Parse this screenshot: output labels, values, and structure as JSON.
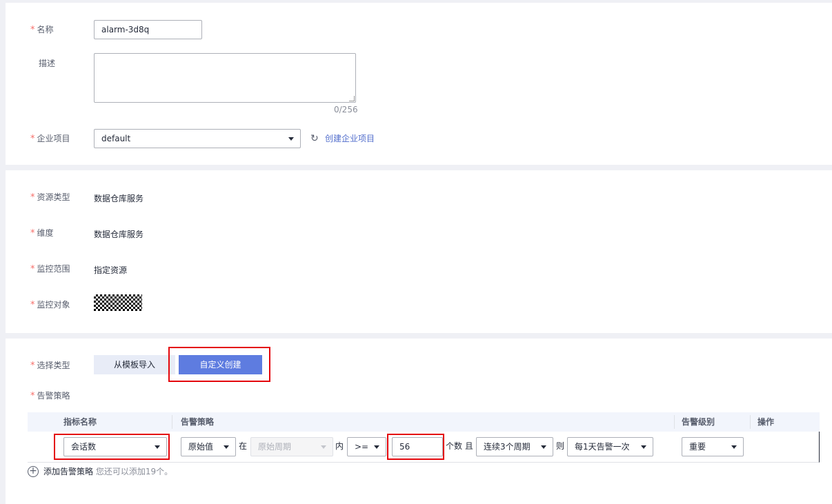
{
  "basic": {
    "name_label": "名称",
    "name_value": "alarm-3d8q",
    "desc_label": "描述",
    "desc_counter": "0/256",
    "enterprise_label": "企业项目",
    "enterprise_value": "default",
    "create_enterprise_link": "创建企业项目"
  },
  "resource": {
    "type_label": "资源类型",
    "type_value": "数据仓库服务",
    "dimension_label": "维度",
    "dimension_value": "数据仓库服务",
    "scope_label": "监控范围",
    "scope_value": "指定资源",
    "object_label": "监控对象"
  },
  "policy": {
    "select_type_label": "选择类型",
    "from_template": "从模板导入",
    "custom_create": "自定义创建",
    "alarm_policy_label": "告警策略",
    "columns": {
      "metric": "指标名称",
      "policy": "告警策略",
      "level": "告警级别",
      "action": "操作"
    },
    "row": {
      "metric": "会话数",
      "value_type": "原始值",
      "in_text": "在",
      "period": "原始周期",
      "within_text": "内",
      "operator": ">=",
      "threshold": "56",
      "count_and": "个数 且",
      "consecutive": "连续3个周期",
      "then_text": "则",
      "frequency": "每1天告警一次",
      "level": "重要"
    },
    "add_label": "添加告警策略",
    "add_hint": "您还可以添加19个。"
  },
  "colors": {
    "accent": "#5e7ce0",
    "link": "#526ecc",
    "required": "#f66f6a",
    "highlight": "#e4060c"
  }
}
